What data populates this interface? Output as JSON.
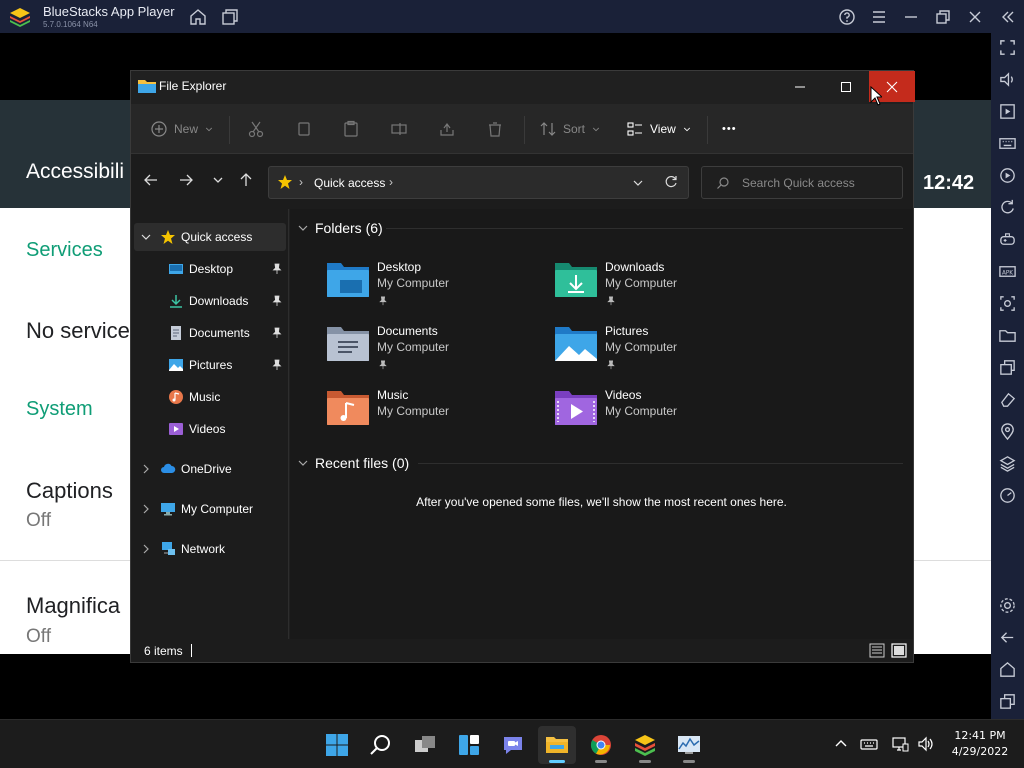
{
  "bluestacks": {
    "title": "BlueStacks App Player",
    "version": "5.7.0.1064  N64"
  },
  "android": {
    "header_title": "Accessibili",
    "clock": "12:42",
    "services_section": "Services",
    "no_services": "No services",
    "system_section": "System",
    "captions_title": "Captions",
    "captions_value": "Off",
    "magnification_title": "Magnifica",
    "magnification_value": "Off"
  },
  "explorer": {
    "window_title": "File Explorer",
    "toolbar": {
      "new_label": "New",
      "sort_label": "Sort",
      "view_label": "View",
      "more_label": "•••"
    },
    "address": {
      "path": "Quick access",
      "separator": "›"
    },
    "search": {
      "placeholder": "Search Quick access"
    },
    "nav": {
      "quick_access": "Quick access",
      "items": [
        {
          "label": "Desktop",
          "pinned": true
        },
        {
          "label": "Downloads",
          "pinned": true
        },
        {
          "label": "Documents",
          "pinned": true
        },
        {
          "label": "Pictures",
          "pinned": true
        },
        {
          "label": "Music",
          "pinned": false
        },
        {
          "label": "Videos",
          "pinned": false
        }
      ],
      "onedrive": "OneDrive",
      "my_computer": "My Computer",
      "network": "Network"
    },
    "folders_header": "Folders (6)",
    "folders": [
      {
        "name": "Desktop",
        "location": "My Computer",
        "pinned": true
      },
      {
        "name": "Downloads",
        "location": "My Computer",
        "pinned": true
      },
      {
        "name": "Documents",
        "location": "My Computer",
        "pinned": true
      },
      {
        "name": "Pictures",
        "location": "My Computer",
        "pinned": true
      },
      {
        "name": "Music",
        "location": "My Computer",
        "pinned": false
      },
      {
        "name": "Videos",
        "location": "My Computer",
        "pinned": false
      }
    ],
    "recent_header": "Recent files (0)",
    "recent_empty_message": "After you've opened some files, we'll show the most recent ones here.",
    "status": "6 items"
  },
  "taskbar": {
    "time": "12:41 PM",
    "date": "4/29/2022"
  },
  "colors": {
    "bs_chrome": "#1a2138",
    "android_accent": "#0f9d76",
    "close_red": "#c42b1c",
    "taskbar_accent": "#60cdff"
  }
}
